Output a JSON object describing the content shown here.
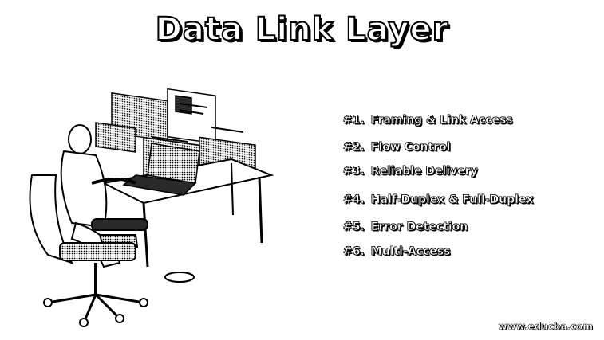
{
  "title": "Data Link Layer",
  "topics": [
    {
      "number": "#1.",
      "label": "Framing & Link Access"
    },
    {
      "number": "#2.",
      "label": "Flow Control"
    },
    {
      "number": "#3.",
      "label": "Reliable Delivery"
    },
    {
      "number": "#4.",
      "label": "Half-Duplex & Full-Duplex"
    },
    {
      "number": "#5.",
      "label": "Error Detection"
    },
    {
      "number": "#6.",
      "label": "Multi-Access"
    }
  ],
  "watermark": "www.educba.com",
  "illustration": {
    "subject": "person-at-laptop-icon",
    "colors": {
      "ink": "#000000",
      "paper": "#ffffff",
      "shade": "#9a9a9a"
    }
  }
}
